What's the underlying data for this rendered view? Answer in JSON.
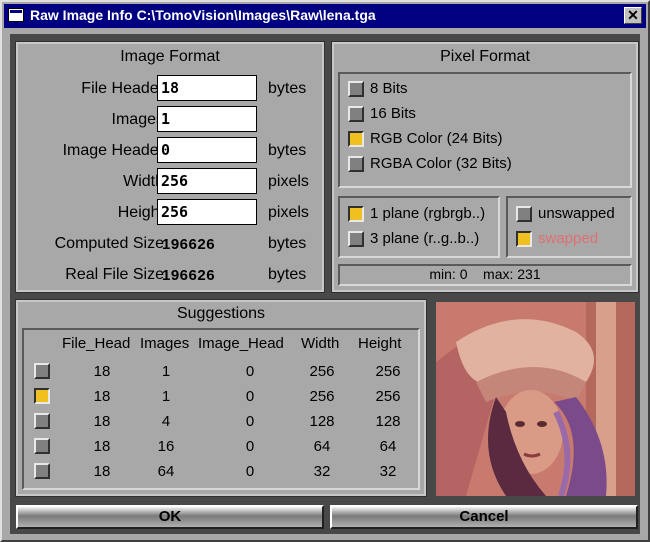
{
  "window": {
    "title": "Raw Image Info C:\\TomoVision\\Images\\Raw\\lena.tga",
    "close_glyph": "✕"
  },
  "image_format": {
    "title": "Image Format",
    "fields": [
      {
        "label": "File Header",
        "value": "18",
        "unit": "bytes"
      },
      {
        "label": "Images",
        "value": "1",
        "unit": ""
      },
      {
        "label": "Image Header",
        "value": "0",
        "unit": "bytes"
      },
      {
        "label": "Width",
        "value": "256",
        "unit": "pixels"
      },
      {
        "label": "Height",
        "value": "256",
        "unit": "pixels"
      }
    ],
    "computed_size": {
      "label": "Computed Size",
      "value": "196626",
      "unit": "bytes"
    },
    "real_size": {
      "label": "Real File Size",
      "value": "196626",
      "unit": "bytes"
    }
  },
  "pixel_format": {
    "title": "Pixel Format",
    "options": [
      {
        "label": "8 Bits",
        "checked": false
      },
      {
        "label": "16 Bits",
        "checked": false
      },
      {
        "label": "RGB Color (24 Bits)",
        "checked": true
      },
      {
        "label": "RGBA Color (32 Bits)",
        "checked": false
      }
    ],
    "planes": [
      {
        "label": "1 plane (rgbrgb..)",
        "checked": true
      },
      {
        "label": "3 plane (r..g..b..)",
        "checked": false
      }
    ],
    "swap": [
      {
        "label": "unswapped",
        "checked": false
      },
      {
        "label": "swapped",
        "checked": true
      }
    ],
    "minmax": "min: 0    max: 231"
  },
  "suggestions": {
    "title": "Suggestions",
    "columns": [
      "File_Head",
      "Images",
      "Image_Head",
      "Width",
      "Height"
    ],
    "rows": [
      {
        "checked": false,
        "cells": [
          "18",
          "1",
          "0",
          "256",
          "256"
        ]
      },
      {
        "checked": true,
        "cells": [
          "18",
          "1",
          "0",
          "256",
          "256"
        ]
      },
      {
        "checked": false,
        "cells": [
          "18",
          "4",
          "0",
          "128",
          "128"
        ]
      },
      {
        "checked": false,
        "cells": [
          "18",
          "16",
          "0",
          "64",
          "64"
        ]
      },
      {
        "checked": false,
        "cells": [
          "18",
          "64",
          "0",
          "32",
          "32"
        ]
      }
    ]
  },
  "buttons": {
    "ok": "OK",
    "cancel": "Cancel"
  },
  "colors": {
    "title_bar": "#000080",
    "checked": "#f0c020",
    "swapped_text": "#e07070"
  }
}
